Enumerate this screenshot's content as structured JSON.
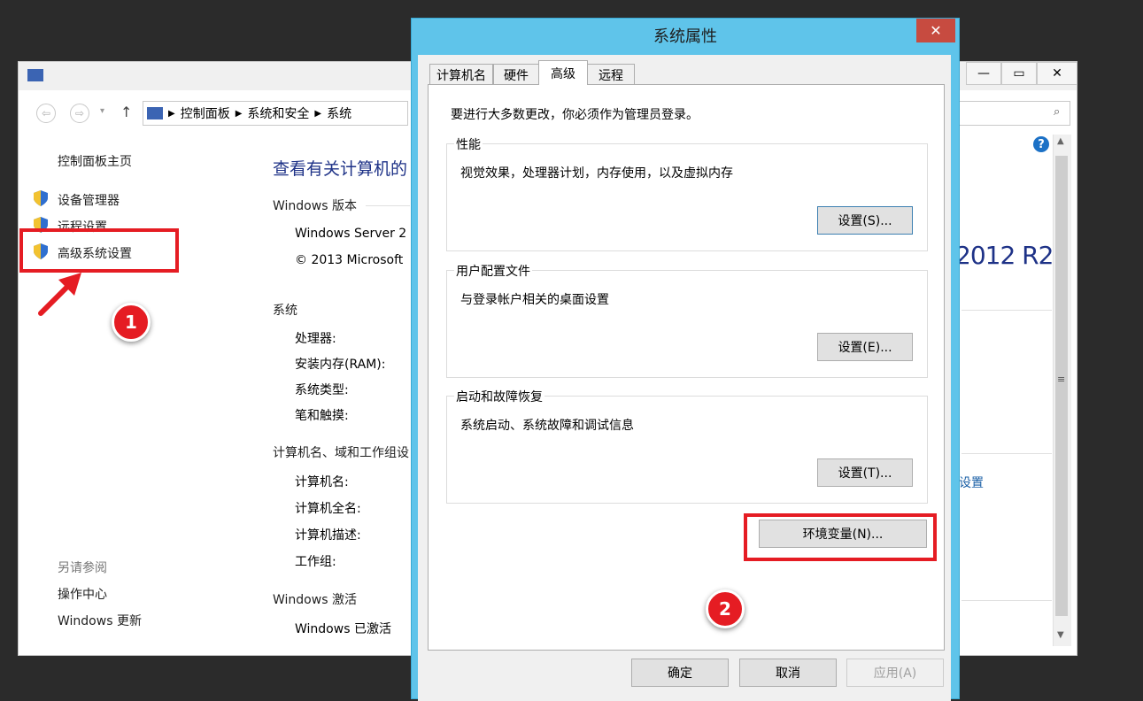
{
  "dialog": {
    "title": "系统属性",
    "tabs": [
      {
        "label": "计算机名"
      },
      {
        "label": "硬件"
      },
      {
        "label": "高级",
        "active": true
      },
      {
        "label": "远程"
      }
    ],
    "admin_note": "要进行大多数更改，你必须作为管理员登录。",
    "groups": [
      {
        "title": "性能",
        "desc": "视觉效果，处理器计划，内存使用，以及虚拟内存",
        "button": "设置(S)..."
      },
      {
        "title": "用户配置文件",
        "desc": "与登录帐户相关的桌面设置",
        "button": "设置(E)..."
      },
      {
        "title": "启动和故障恢复",
        "desc": "系统启动、系统故障和调试信息",
        "button": "设置(T)..."
      }
    ],
    "env_button": "环境变量(N)...",
    "footer": {
      "ok": "确定",
      "cancel": "取消",
      "apply": "应用(A)"
    }
  },
  "control_panel": {
    "breadcrumb": [
      "控制面板",
      "系统和安全",
      "系统"
    ],
    "sidebar": {
      "home": "控制面板主页",
      "links": [
        "设备管理器",
        "远程设置",
        "高级系统设置"
      ],
      "see_also_title": "另请参阅",
      "see_also": [
        "操作中心",
        "Windows 更新"
      ]
    },
    "heading": "查看有关计算机的",
    "windows_version": {
      "title": "Windows 版本",
      "edition": "Windows Server 2",
      "copyright": "© 2013 Microsoft",
      "brand_fragment": "2012 R2"
    },
    "system": {
      "title": "系统",
      "rows": [
        "处理器:",
        "安装内存(RAM):",
        "系统类型:",
        "笔和触摸:"
      ]
    },
    "computer_name": {
      "title": "计算机名、域和工作组设",
      "rows": [
        "计算机名:",
        "计算机全名:",
        "计算机描述:",
        "工作组:"
      ],
      "change_link": "设置"
    },
    "activation": {
      "title": "Windows 激活",
      "status": "Windows 已激活"
    },
    "window_buttons": {
      "restore": "▭",
      "close": "✕"
    }
  },
  "annotations": {
    "step1": "1",
    "step2": "2"
  },
  "colors": {
    "highlight_red": "#e51c23",
    "dialog_frame": "#5fc4ea",
    "close_red": "#c74b40",
    "link_blue": "#1a5fa6"
  }
}
